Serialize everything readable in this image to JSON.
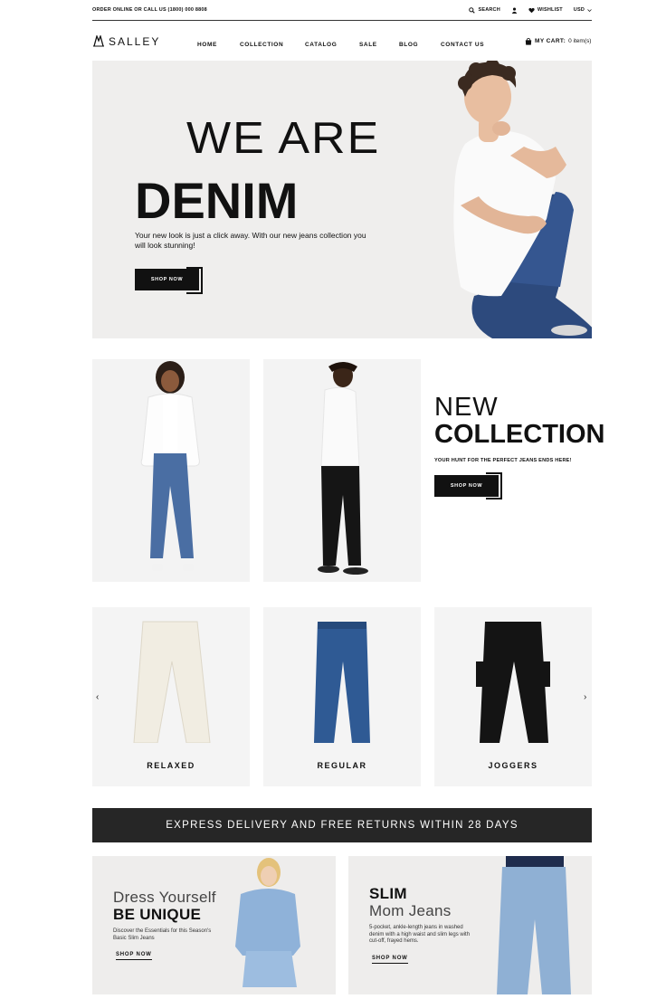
{
  "topbar": {
    "order_text": "ORDER ONLINE OR CALL US (1800) 000 8808",
    "search_label": "SEARCH",
    "wishlist_label": "WISHLIST",
    "currency": "USD"
  },
  "header": {
    "logo_text": "SALLEY",
    "nav": [
      "HOME",
      "COLLECTION",
      "CATALOG",
      "SALE",
      "BLOG",
      "CONTACT US"
    ],
    "cart_label": "MY CART:",
    "cart_count": "0 item(s)"
  },
  "hero": {
    "line1": "WE ARE",
    "line2": "DENIM",
    "subtitle": "Your new look is just a click away. With our new jeans collection you will look stunning!",
    "button": "SHOP NOW"
  },
  "collection": {
    "line1": "NEW",
    "line2": "COLLECTION",
    "subtitle": "YOUR HUNT FOR THE PERFECT JEANS ENDS HERE!",
    "button": "SHOP NOW"
  },
  "categories": [
    {
      "label": "RELAXED",
      "color": "#f0ede4"
    },
    {
      "label": "REGULAR",
      "color": "#2f5a94"
    },
    {
      "label": "JOGGERS",
      "color": "#141414"
    }
  ],
  "carousel": {
    "prev": "‹",
    "next": "›"
  },
  "banner": {
    "text": "EXPRESS DELIVERY AND FREE RETURNS WITHIN 28 DAYS"
  },
  "promos": [
    {
      "light": "Dress Yourself",
      "bold": "BE UNIQUE",
      "text": "Discover the Essentials for this Season's Basic Slim Jeans",
      "link": "SHOP NOW"
    },
    {
      "bold": "SLIM",
      "light": "Mom Jeans",
      "text": "5-pocket, ankle-length jeans in washed denim with a high waist and slim legs with cut-off, frayed hems.",
      "link": "SHOP NOW"
    }
  ]
}
